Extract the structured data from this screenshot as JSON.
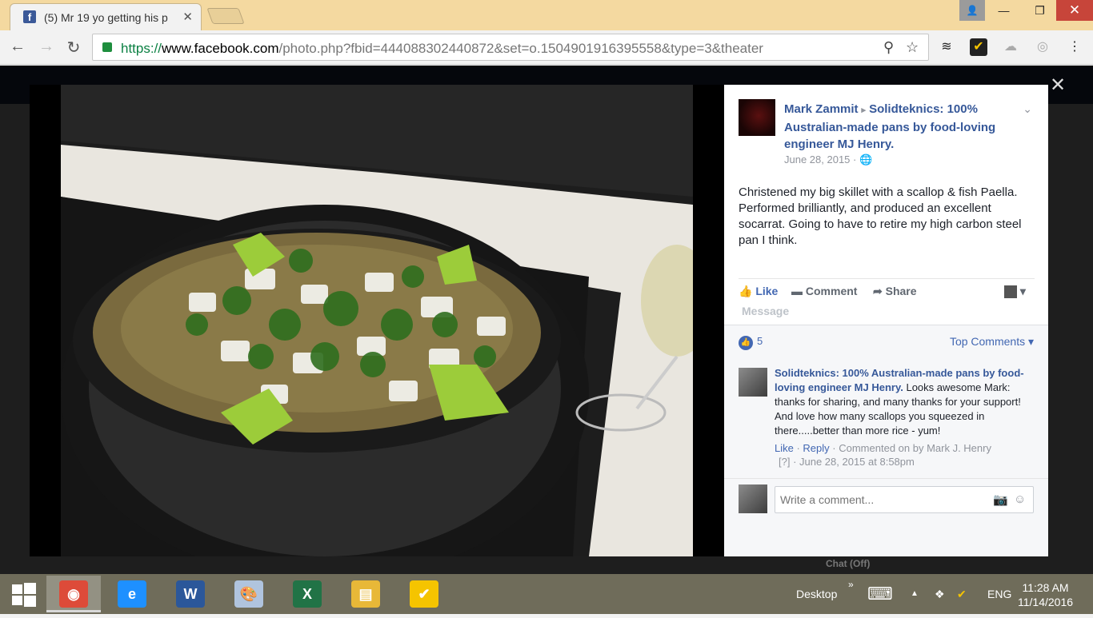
{
  "browser": {
    "tab_title": "(5) Mr 19 yo getting his p",
    "tab_favicon": "f",
    "tab_close": "✕",
    "url_scheme": "https://",
    "url_host": "www.facebook.com",
    "url_path": "/photo.php?fbid=444088302440872&set=o.1504901916395558&type=3&theater",
    "nav_back": "←",
    "nav_forward": "→",
    "nav_reload": "↻",
    "window_min": "—",
    "window_max": "❐",
    "window_close": "✕",
    "window_user": "👤"
  },
  "theater": {
    "close_label": "✕"
  },
  "post": {
    "author": "Mark Zammit",
    "separator": "▸",
    "group": "Solidteknics: 100% Australian-made pans by food-loving engineer MJ Henry.",
    "date": "June 28, 2015 · 🌐",
    "text": "Christened my big skillet with a scallop & fish Paella. Performed brilliantly, and produced an excellent socarrat. Going to have to retire my high carbon steel pan I think.",
    "chevron": "⌄"
  },
  "actions": {
    "like": "Like",
    "comment": "Comment",
    "share": "Share",
    "message": "Message",
    "like_icon": "👍",
    "comment_icon": "▬",
    "share_icon": "➦",
    "dropdown": "▾"
  },
  "reactions": {
    "count": "5",
    "thumb": "👍",
    "sort": "Top Comments ▾"
  },
  "comment": {
    "author": "Solidteknics: 100% Australian-made pans by food-loving engineer MJ Henry.",
    "text": " Looks awesome Mark: thanks for sharing, and many thanks for your support! And love how many scallops you squeezed in there.....better than more rice - yum!",
    "like": "Like",
    "sep1": " · ",
    "reply": "Reply",
    "sep2": " · ",
    "commented_on": "Commented on by Mark J. Henry",
    "meta2": "[?] · June 28, 2015 at 8:58pm"
  },
  "composer": {
    "placeholder": "Write a comment...",
    "camera_icon": "📷",
    "emoji_icon": "☺"
  },
  "chat": "Chat (Off)",
  "taskbar": {
    "desktop": "Desktop",
    "desktop_arrow": "»",
    "lang": "ENG",
    "time": "11:28 AM",
    "date": "11/14/2016",
    "tray_up": "▲",
    "keyboard": "⌨",
    "apps": [
      {
        "name": "Chrome",
        "glyph": "◉",
        "color": "#dd4b39"
      },
      {
        "name": "Internet Explorer",
        "glyph": "e",
        "color": "#1e90ff"
      },
      {
        "name": "Word",
        "glyph": "W",
        "color": "#2b579a"
      },
      {
        "name": "Paint",
        "glyph": "🎨",
        "color": "#b0c4de"
      },
      {
        "name": "Excel",
        "glyph": "X",
        "color": "#217346"
      },
      {
        "name": "File Explorer",
        "glyph": "▤",
        "color": "#e8b838"
      },
      {
        "name": "Norton",
        "glyph": "✔",
        "color": "#f5c400"
      }
    ]
  }
}
